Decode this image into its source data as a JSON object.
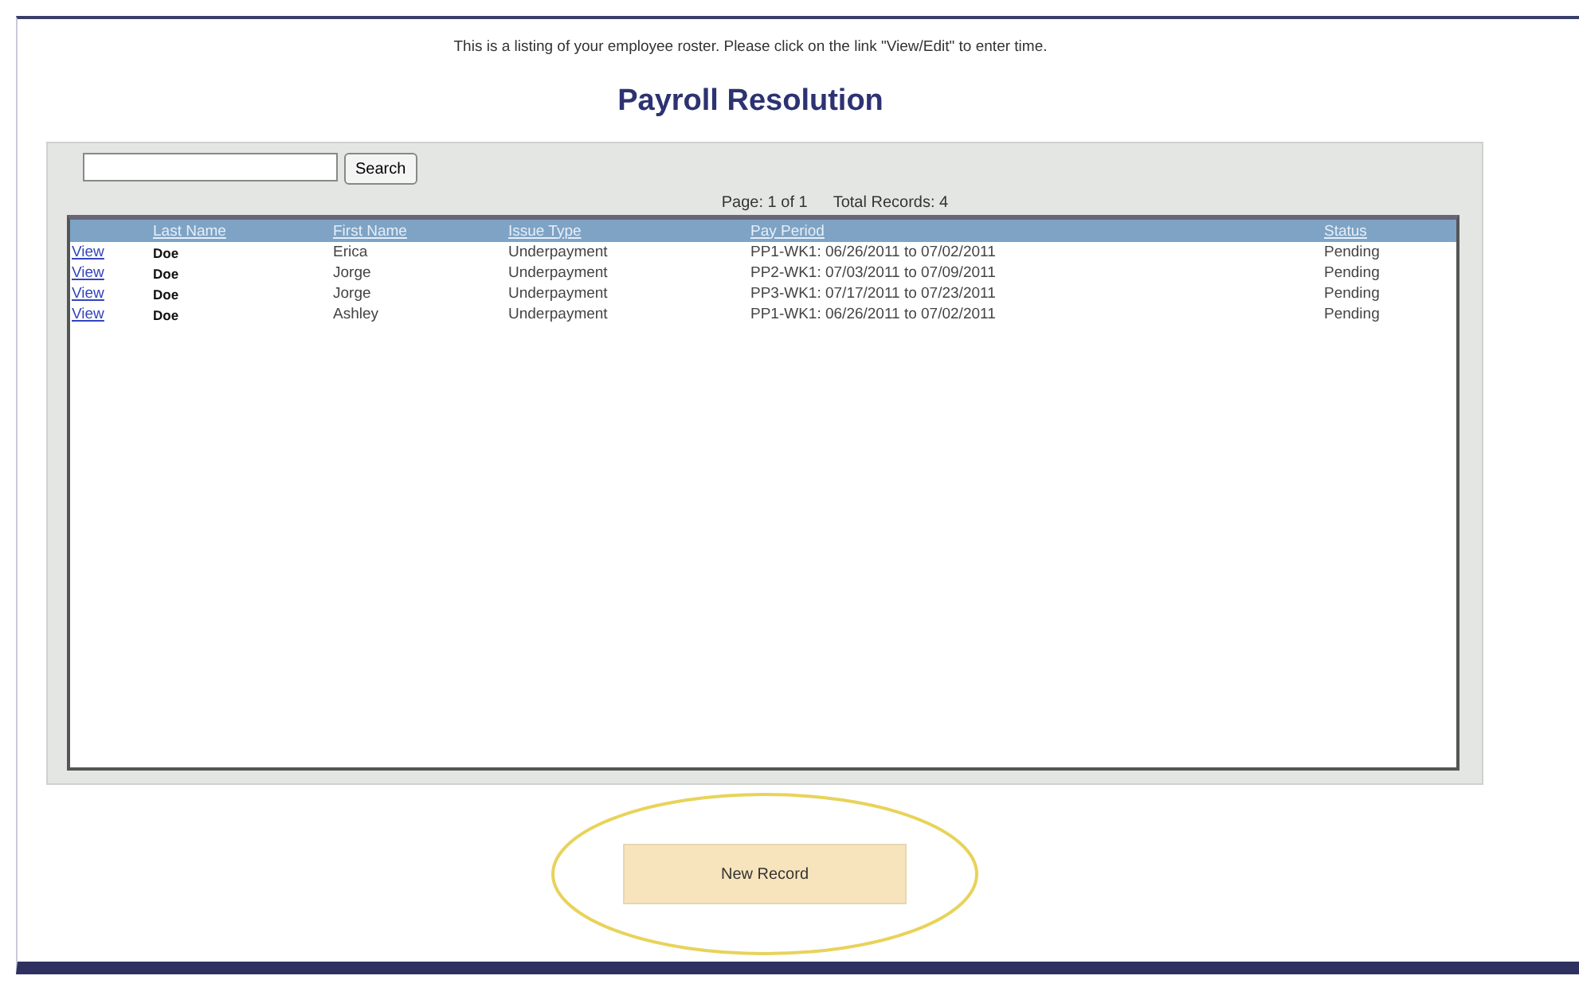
{
  "intro": "This is a listing of your employee roster. Please click on the link \"View/Edit\" to enter time.",
  "title": "Payroll Resolution",
  "search": {
    "button": "Search"
  },
  "pager": {
    "page": "Page: 1 of 1",
    "total": "Total Records: 4"
  },
  "table": {
    "columns": [
      "Last Name",
      "First Name",
      "Issue Type",
      "Pay Period",
      "Status"
    ],
    "rows": [
      {
        "link": "View",
        "cells": [
          "Doe",
          "Erica",
          "Underpayment",
          "PP1-WK1: 06/26/2011 to 07/02/2011",
          "Pending"
        ]
      },
      {
        "link": "View",
        "cells": [
          "Doe",
          "Jorge",
          "Underpayment",
          "PP2-WK1: 07/03/2011 to 07/09/2011",
          "Pending"
        ]
      },
      {
        "link": "View",
        "cells": [
          "Doe",
          "Jorge",
          "Underpayment",
          "PP3-WK1: 07/17/2011 to 07/23/2011",
          "Pending"
        ]
      },
      {
        "link": "View",
        "cells": [
          "Doe",
          "Ashley",
          "Underpayment",
          "PP1-WK1: 06/26/2011 to 07/02/2011",
          "Pending"
        ]
      }
    ]
  },
  "new_record": {
    "label": "New Record",
    "highlighted": true
  }
}
